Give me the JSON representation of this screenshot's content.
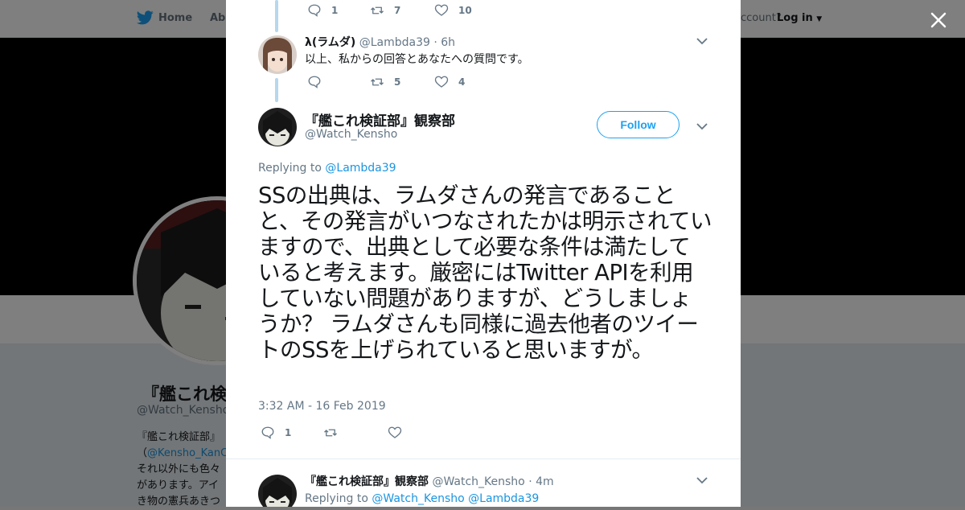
{
  "background": {
    "nav": {
      "home": "Home",
      "about": "Abo",
      "account_prompt": "ccount?",
      "login": "Log in"
    },
    "profile": {
      "name": "『艦これ検証",
      "handle": "@Watch_Kensho",
      "bio_line1": "『艦これ検証部』",
      "bio_line2_prefix": "（",
      "bio_line2_link": "@Kensho_KanC",
      "bio_line3": "それ以外にも色々",
      "bio_line4": "があります。アイ",
      "bio_line5": "き物の憲兵あきつ"
    }
  },
  "thread": {
    "first_tweet_actions": {
      "replies": "1",
      "retweets": "7",
      "likes": "10"
    },
    "reply_tweet": {
      "name": "λ(ラムダ)",
      "handle": "@Lambda39",
      "time": "· 6h",
      "text": "以上、私からの回答とあなたへの質問です。",
      "replies": "",
      "retweets": "5",
      "likes": "4"
    },
    "main_tweet": {
      "name": "『艦これ検証部』観察部",
      "handle": "@Watch_Kensho",
      "follow_label": "Follow",
      "replying_prefix": "Replying to",
      "replying_to": "@Lambda39",
      "text": "SSの出典は、ラムダさんの発言であることと、その発言がいつなされたかは明示されていますので、出典として必要な条件は満たしていると考えます。厳密にはTwitter APIを利用していない問題がありますが、どうしましょうか？ ラムダさんも同様に過去他者のツイートのSSを上げられていると思いますが。",
      "timestamp": "3:32 AM - 16 Feb 2019",
      "replies": "1",
      "retweets": "",
      "likes": ""
    },
    "next_tweet": {
      "name": "『艦これ検証部』観察部",
      "handle": "@Watch_Kensho",
      "time": "· 4m",
      "replying_prefix": "Replying to",
      "replying_to_1": "@Watch_Kensho",
      "replying_to_2": "@Lambda39"
    }
  },
  "icons": {
    "brand": "twitter-bird-icon",
    "close": "close-icon",
    "reply": "reply-icon",
    "retweet": "retweet-icon",
    "like": "heart-icon",
    "more": "chevron-down-icon"
  },
  "colors": {
    "brand_blue": "#1da1f2",
    "link_blue": "#1b95e0",
    "thread_line": "#b7d7ee",
    "muted_text": "#657786",
    "overlay": "rgba(0,0,0,0.5)"
  }
}
